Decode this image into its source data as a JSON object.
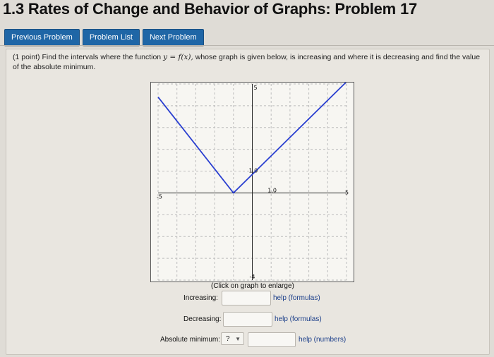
{
  "page": {
    "title": "1.3 Rates of Change and Behavior of Graphs: Problem 17"
  },
  "nav": {
    "previous_label": "Previous Problem",
    "list_label": "Problem List",
    "next_label": "Next Problem",
    "color": "#1f66a6"
  },
  "question": {
    "points": "(1 point)",
    "text_before": "Find the intervals where the function",
    "function": "y = f(x),",
    "text_after": "whose graph is given below, is increasing and where it is decreasing and find the value of the absolute minimum."
  },
  "graph": {
    "x_range": [
      -5,
      5
    ],
    "y_range": [
      -4,
      5
    ],
    "labels": {
      "top": "5",
      "bottom": "-4",
      "left": "-5",
      "right": "5",
      "point_y": "1,0",
      "point_x": "1,0"
    },
    "curve": {
      "points": [
        [
          -5,
          4.4
        ],
        [
          -1,
          0
        ],
        [
          5,
          5.1
        ]
      ],
      "color": "#2a3fd0"
    },
    "caption": "(Click on graph to enlarge)"
  },
  "answers": {
    "increasing": {
      "label": "Increasing:",
      "help": "help (formulas)"
    },
    "decreasing": {
      "label": "Decreasing:",
      "help": "help (formulas)"
    },
    "absolute_minimum": {
      "label": "Absolute minimum:",
      "select_value": "?",
      "help": "help (numbers)"
    }
  }
}
